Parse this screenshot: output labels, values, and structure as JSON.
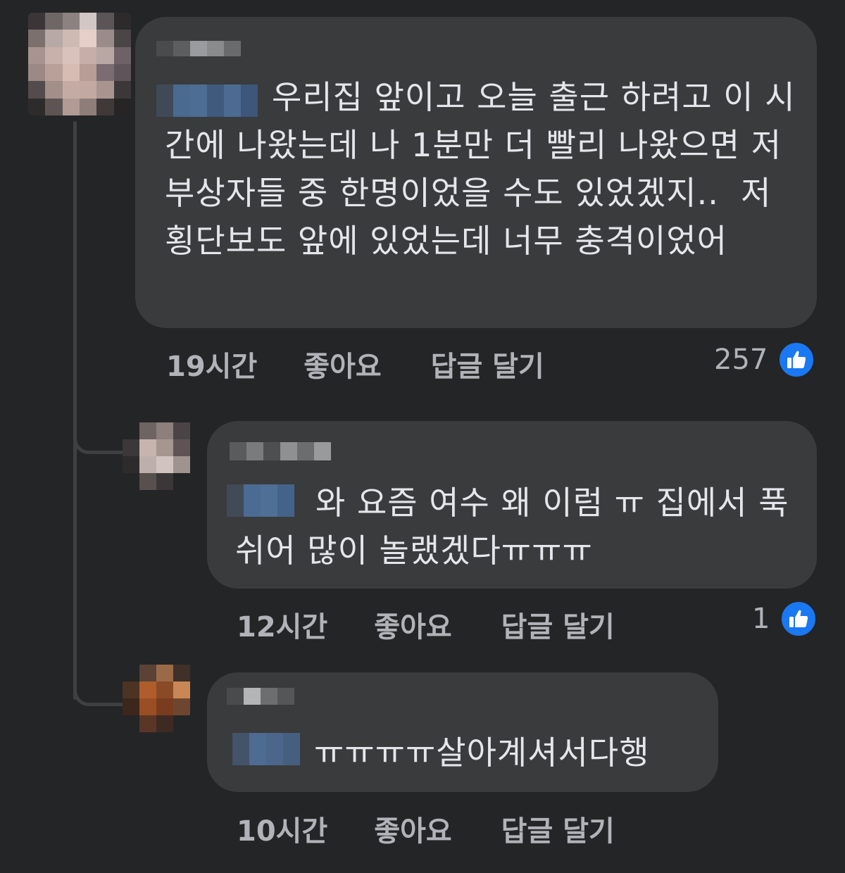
{
  "comments": [
    {
      "text": "우리집 앞이고 오늘 출근 하려고 이 시간에 나왔는데 나 1분만 더 빨리 나왔으면 저 부상자들 중 한명이었을 수도 있었겠지..  저 횡단보도 앞에 있었는데 너무 충격이었어",
      "time": "19시간",
      "like_label": "좋아요",
      "reply_label": "답글 달기",
      "reaction_count": "257"
    },
    {
      "text": "와 요즘 여수 왜 이럼 ㅠ 집에서 푹 쉬어 많이 놀랬겠다ㅠㅠㅠ",
      "time": "12시간",
      "like_label": "좋아요",
      "reply_label": "답글 달기",
      "reaction_count": "1"
    },
    {
      "text": "ㅠㅠㅠㅠ살아계셔서다행",
      "time": "10시간",
      "like_label": "좋아요",
      "reply_label": "답글 달기"
    }
  ],
  "colors": {
    "background": "#242526",
    "bubble": "#3a3b3c",
    "text": "#e4e6eb",
    "meta": "#b0b3b8",
    "like_badge": "#1a78f2"
  },
  "icons": {
    "reaction": "thumbs-up-icon"
  }
}
